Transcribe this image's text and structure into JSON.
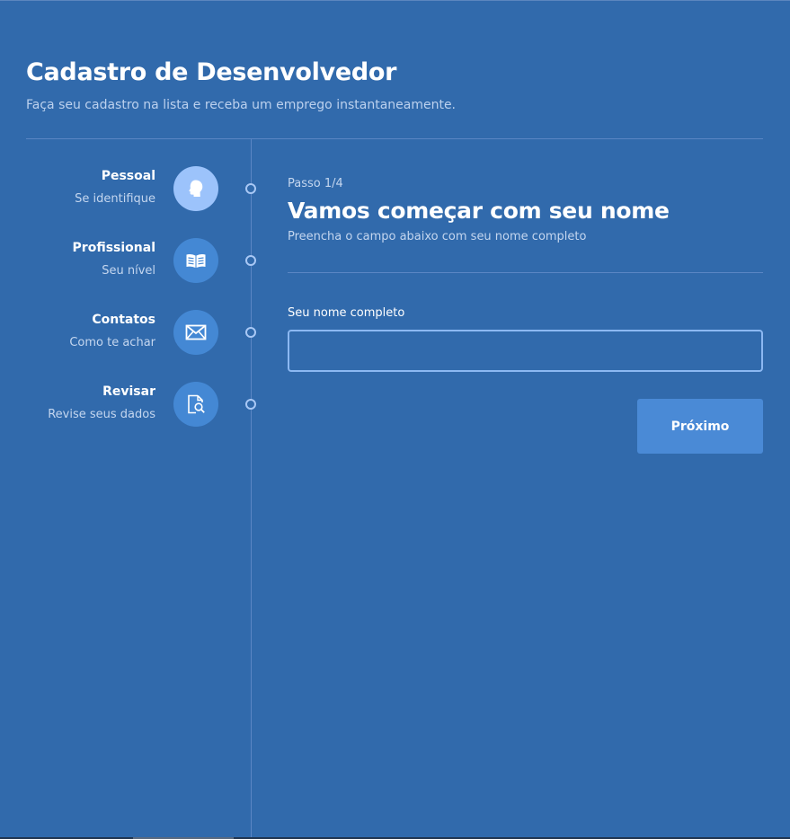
{
  "header": {
    "title": "Cadastro de Desenvolvedor",
    "subtitle": "Faça seu cadastro na lista e receba um emprego instantaneamente."
  },
  "steps": [
    {
      "title": "Pessoal",
      "subtitle": "Se identifique",
      "icon": "head-icon",
      "active": true
    },
    {
      "title": "Profissional",
      "subtitle": "Seu nível",
      "icon": "book-icon",
      "active": false
    },
    {
      "title": "Contatos",
      "subtitle": "Como te achar",
      "icon": "mail-icon",
      "active": false
    },
    {
      "title": "Revisar",
      "subtitle": "Revise seus dados",
      "icon": "document-search-icon",
      "active": false
    }
  ],
  "content": {
    "step_counter": "Passo 1/4",
    "title": "Vamos começar com seu nome",
    "subtitle": "Preencha o campo abaixo com seu nome completo",
    "field_label": "Seu nome completo",
    "field_value": "",
    "next_label": "Próximo"
  },
  "colors": {
    "background": "#316aac",
    "step_icon": "#4488d4",
    "step_icon_active": "#9cc3fb",
    "input_border": "#8cb8f2",
    "button": "#4a8ad6"
  }
}
